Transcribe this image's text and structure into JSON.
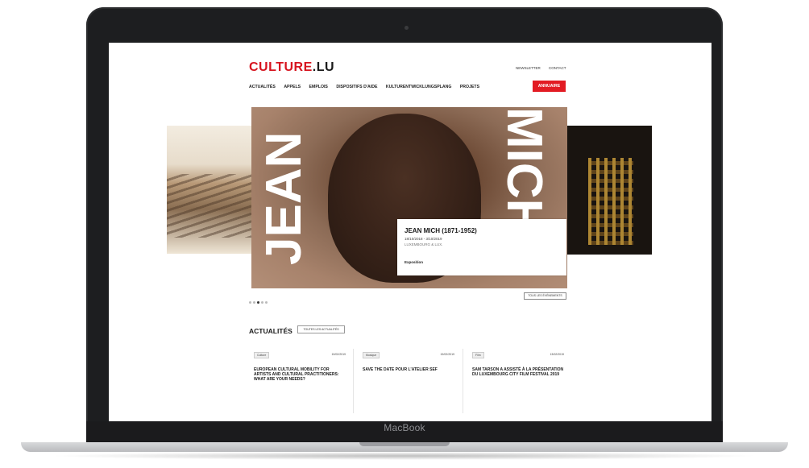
{
  "device": {
    "brand": "MacBook"
  },
  "site": {
    "logo": {
      "part1": "CULTURE",
      "part2": ".LU"
    },
    "top_links": [
      "NEWSLETTER",
      "CONTACT"
    ],
    "nav": {
      "items": [
        "ACTUALITÉS",
        "APPELS",
        "EMPLOIS",
        "DISPOSITIFS D'AIDE",
        "KULTURENTWICKLUNGSPLANG",
        "PROJETS"
      ],
      "cta": "ANNUAIRE"
    },
    "slider": {
      "headline_left": "JEAN",
      "headline_right": "MICH",
      "caption": {
        "title": "JEAN MICH (1871-1952)",
        "dates": "18/10/2018 - 3/10/2019",
        "place": "LUXEMBOURG & LUX.",
        "category": "Exposition"
      },
      "dots": 5,
      "active_dot": 2,
      "all_events_label": "TOUS LES ÉVÉNEMENTS"
    },
    "news": {
      "title": "ACTUALITÉS",
      "all_label": "TOUTES LES ACTUALITÉS",
      "cards": [
        {
          "category": "Culture",
          "date": "19/02/2019",
          "title": "EUROPEAN CULTURAL MOBILITY FOR ARTISTS AND CULTURAL PRACTITIONERS: WHAT ARE YOUR NEEDS?"
        },
        {
          "category": "Musique",
          "date": "19/02/2019",
          "title": "SAVE THE DATE POUR L'ATELIER SEF"
        },
        {
          "category": "Film",
          "date": "13/02/2019",
          "title": "SAM TARSON A ASSISTÉ À LA PRÉSENTATION DU LUXEMBOURG CITY FILM FESTIVAL 2019"
        }
      ]
    }
  }
}
